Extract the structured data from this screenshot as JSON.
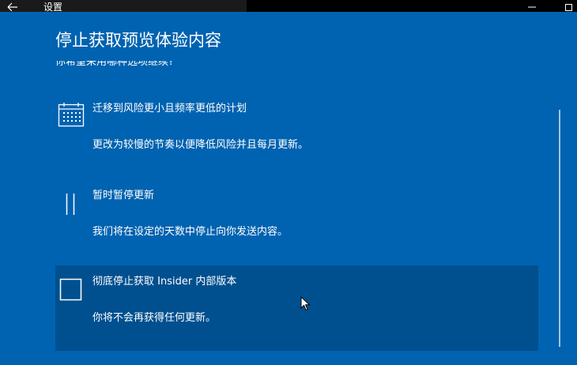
{
  "window": {
    "title": "设置"
  },
  "dialog": {
    "title": "停止获取预览体验内容",
    "question_partial": "你希望采用哪种选项继续?",
    "options": [
      {
        "icon": "calendar-icon",
        "title": "迁移到风险更小且频率更低的计划",
        "description": "更改为较慢的节奏以便降低风险并且每月更新。"
      },
      {
        "icon": "pause-icon",
        "title": "暂时暂停更新",
        "description": "我们将在设定的天数中停止向你发送内容。"
      },
      {
        "icon": "stop-icon",
        "title": "彻底停止获取 Insider 内部版本",
        "description": "你将不会再获得任何更新。"
      }
    ]
  },
  "colors": {
    "dialog_bg": "#0063b1",
    "selected_bg": "#00508f",
    "titlebar_bg": "#000000",
    "text": "#ffffff"
  }
}
